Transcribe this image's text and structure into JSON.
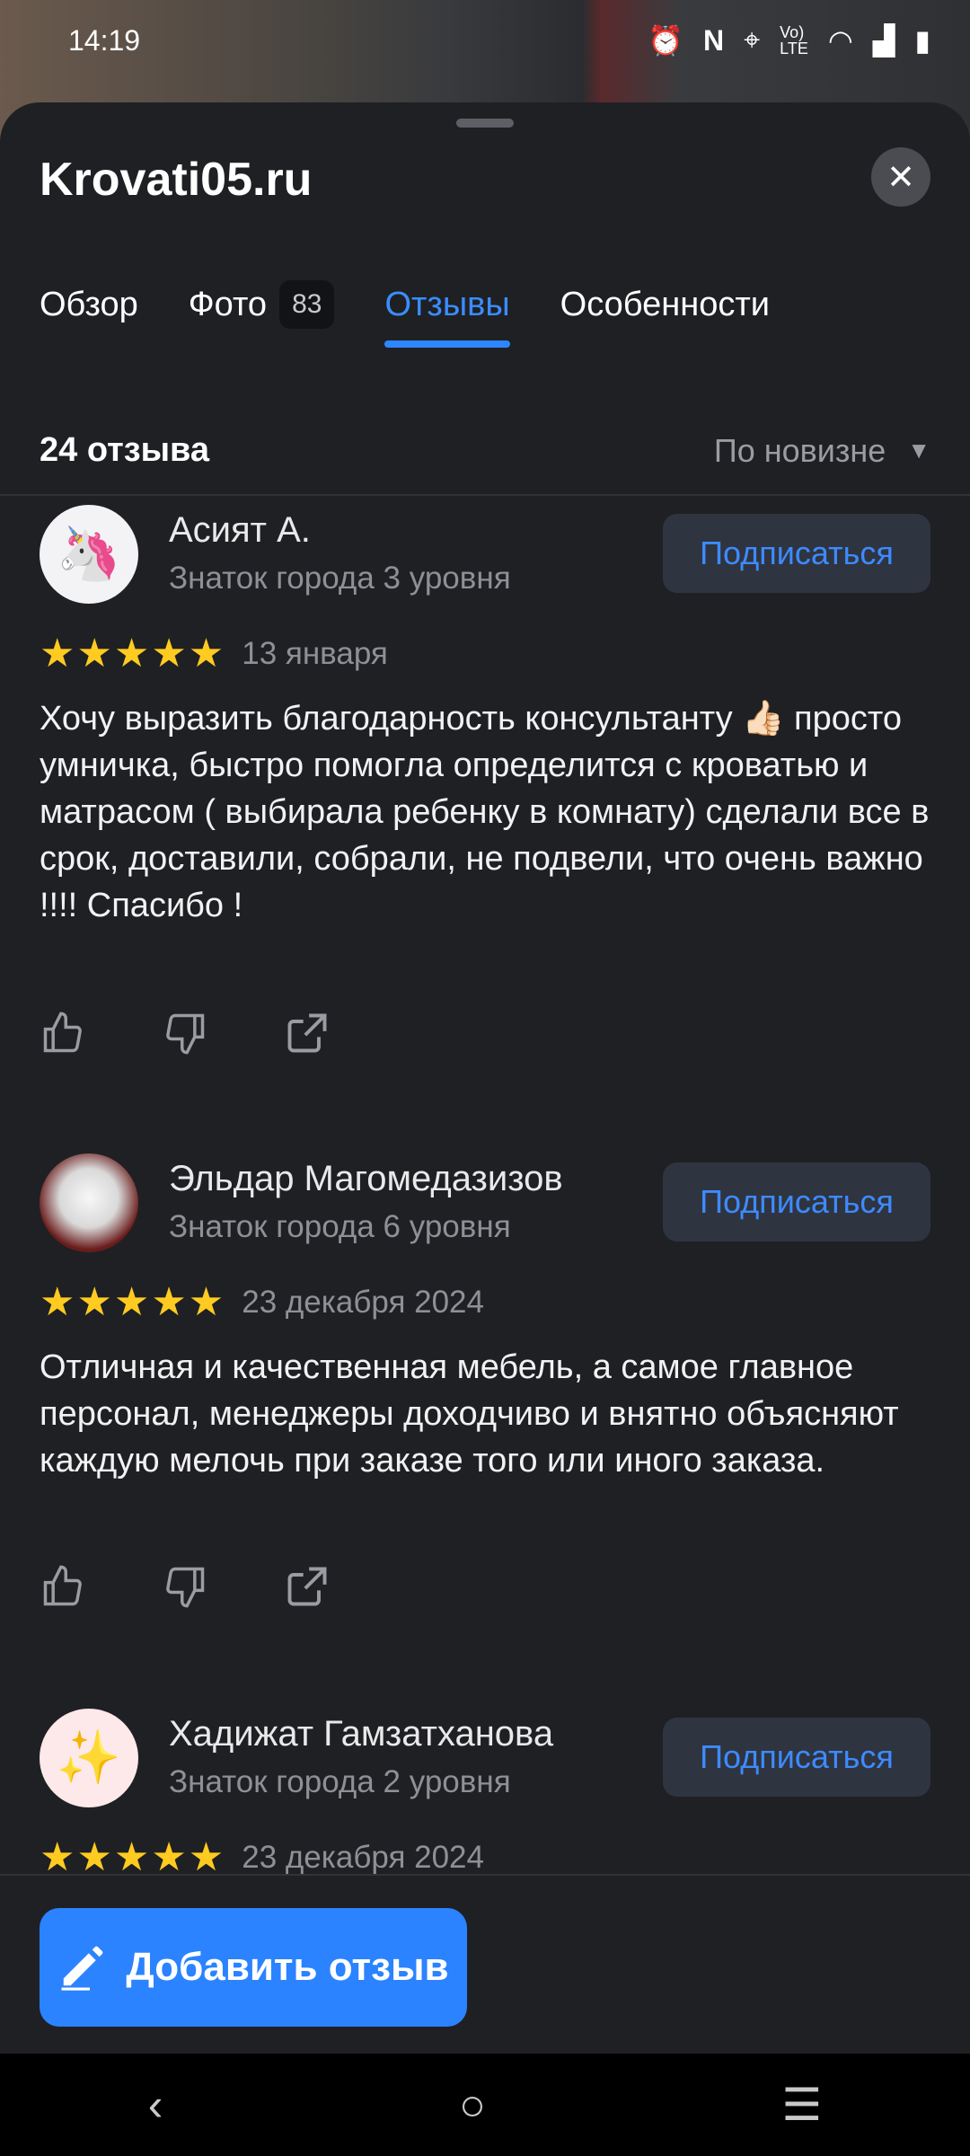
{
  "status_bar": {
    "time": "14:19",
    "icons": [
      "alarm-icon",
      "nfc-icon",
      "location-icon",
      "volte-icon",
      "wifi-icon",
      "signal-icon",
      "battery-icon"
    ]
  },
  "sheet": {
    "title": "Krovati05.ru"
  },
  "tabs": [
    {
      "label": "Обзор",
      "active": false
    },
    {
      "label": "Фото",
      "badge": "83",
      "active": false
    },
    {
      "label": "Отзывы",
      "active": true
    },
    {
      "label": "Особенности",
      "active": false
    }
  ],
  "reviews_header": {
    "count": "24 отзыва",
    "sort": "По новизне"
  },
  "reviews": [
    {
      "author": "Асият А.",
      "level": "Знаток города 3 уровня",
      "subscribe": "Подписаться",
      "stars": "★★★★★",
      "date": "13 января",
      "text": "Хочу выразить благодарность консультанту 👍🏻 просто умничка, быстро помогла определится с кроватью и матрасом ( выбирала ребенку в комнату) сделали все в срок, доставили, собрали, не подвели, что очень важно !!!! Спасибо !",
      "avatar": "🦄"
    },
    {
      "author": "Эльдар Магомедазизов",
      "level": "Знаток города 6 уровня",
      "subscribe": "Подписаться",
      "stars": "★★★★★",
      "date": "23 декабря 2024",
      "text": "Отличная и качественная мебель, а самое главное персонал, менеджеры доходчиво и внятно объясняют каждую мелочь при заказе того или иного заказа.",
      "avatar": ""
    },
    {
      "author": "Хадижат Гамзатханова",
      "level": "Знаток города 2 уровня",
      "subscribe": "Подписаться",
      "stars": "★★★★★",
      "date": "23 декабря 2024",
      "avatar": "✨"
    }
  ],
  "add_review": {
    "label": "Добавить отзыв"
  },
  "colors": {
    "accent": "#2b83ff",
    "star": "#ffcb20",
    "background": "#1f2024"
  }
}
